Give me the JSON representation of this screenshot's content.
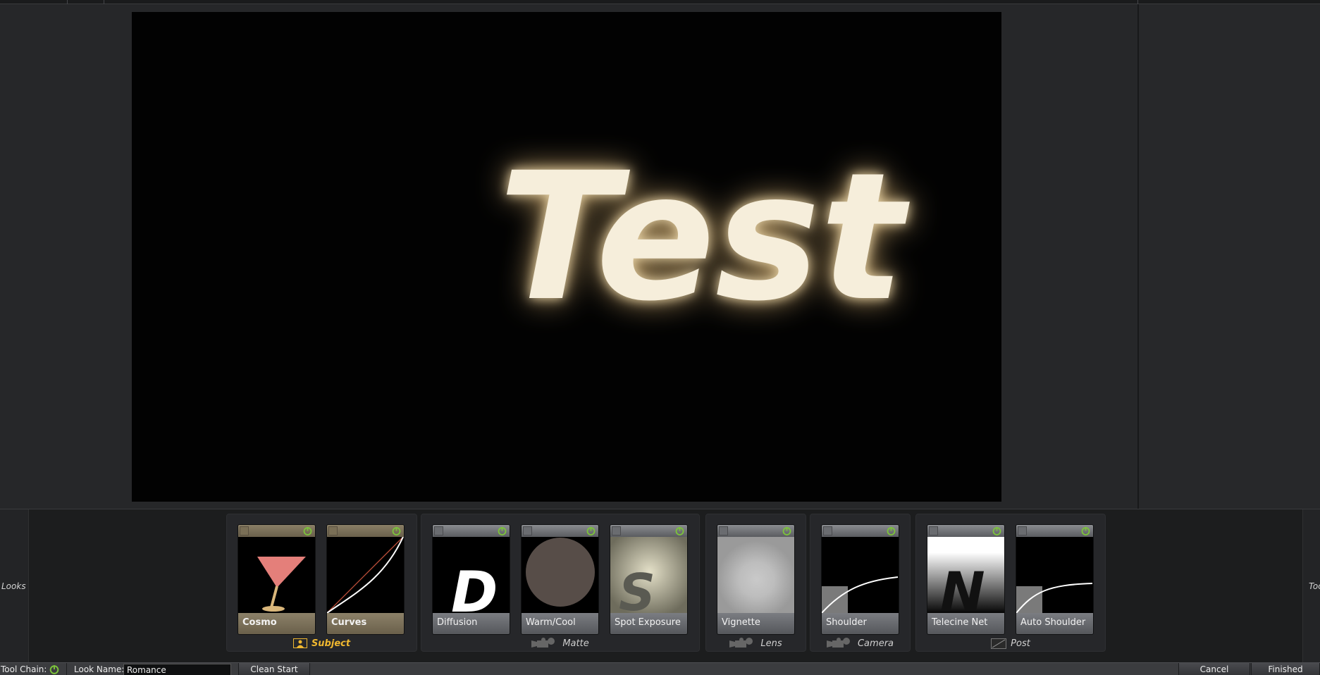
{
  "viewer": {
    "text": "Test"
  },
  "side_labels": {
    "left": "Looks",
    "right": "Tools"
  },
  "groups": [
    {
      "label": "Subject",
      "cards": [
        "Cosmo",
        "Curves"
      ]
    },
    {
      "label": "Matte",
      "cards": [
        "Diffusion",
        "Warm/Cool",
        "Spot Exposure"
      ]
    },
    {
      "label": "Lens",
      "cards": [
        "Vignette"
      ]
    },
    {
      "label": "Camera",
      "cards": [
        "Shoulder"
      ]
    },
    {
      "label": "Post",
      "cards": [
        "Telecine Net",
        "Auto Shoulder"
      ]
    }
  ],
  "bottom_bar": {
    "tool_chain_label": "Tool Chain:",
    "look_name_label": "Look Name:",
    "look_name_value": "Romance",
    "clean_start": "Clean Start",
    "cancel": "Cancel",
    "finished": "Finished"
  },
  "colors": {
    "accent_subject": "#f0b830",
    "power_green": "#7cc43a",
    "glow": "#f6ecd6"
  }
}
